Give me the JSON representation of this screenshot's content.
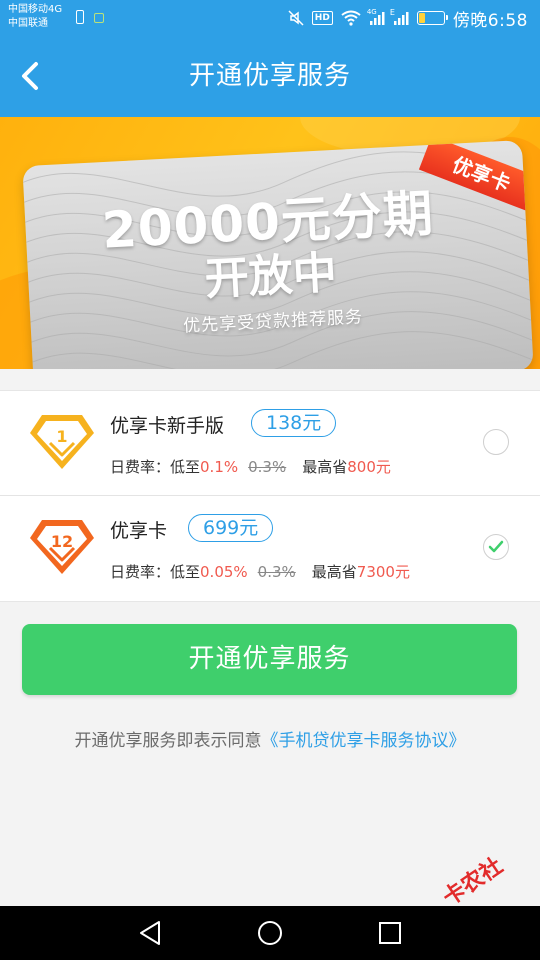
{
  "status_bar": {
    "carrier_primary": "中国移动4G",
    "carrier_secondary": "中国联通",
    "hd_label": "HD",
    "signal_1_label": "4G",
    "signal_2_label": "E",
    "time": "傍晚6:58",
    "battery_level": 0.25
  },
  "header": {
    "title": "开通优享服务"
  },
  "banner": {
    "ribbon_label": "优享卡",
    "headline": "20000元分期",
    "subheadline": "开放中",
    "tagline": "优先享受贷款推荐服务"
  },
  "options": [
    {
      "name": "优享卡新手版",
      "badge_number": "1",
      "price": "138元",
      "rate_prefix": "日费率：低至",
      "rate_value": "0.1%",
      "rate_original": "0.3%",
      "saving_prefix": "最高省",
      "saving_value": "800元",
      "selected": false,
      "badge_color": "#f6b21e"
    },
    {
      "name": "优享卡",
      "badge_number": "12",
      "price": "699元",
      "rate_prefix": "日费率：低至",
      "rate_value": "0.05%",
      "rate_original": "0.3%",
      "saving_prefix": "最高省",
      "saving_value": "7300元",
      "selected": true,
      "badge_color": "#f2671f"
    }
  ],
  "actions": {
    "open_button_label": "开通优享服务"
  },
  "agreement": {
    "prefix": "开通优享服务即表示同意",
    "link": "《手机贷优享卡服务协议》"
  },
  "watermark": {
    "mark": "卡",
    "text": "卡农社区"
  },
  "colors": {
    "primary_blue": "#2ea0e6",
    "button_green": "#3fcf6c",
    "highlight_red": "#f05a4f"
  },
  "icons": {
    "back": "back-arrow-icon",
    "mute": "mute-icon",
    "wifi": "wifi-icon",
    "signal": "signal-icon",
    "battery": "battery-icon",
    "check": "check-icon",
    "nav_back": "triangle-back-icon",
    "nav_home": "circle-home-icon",
    "nav_recents": "square-recents-icon"
  }
}
